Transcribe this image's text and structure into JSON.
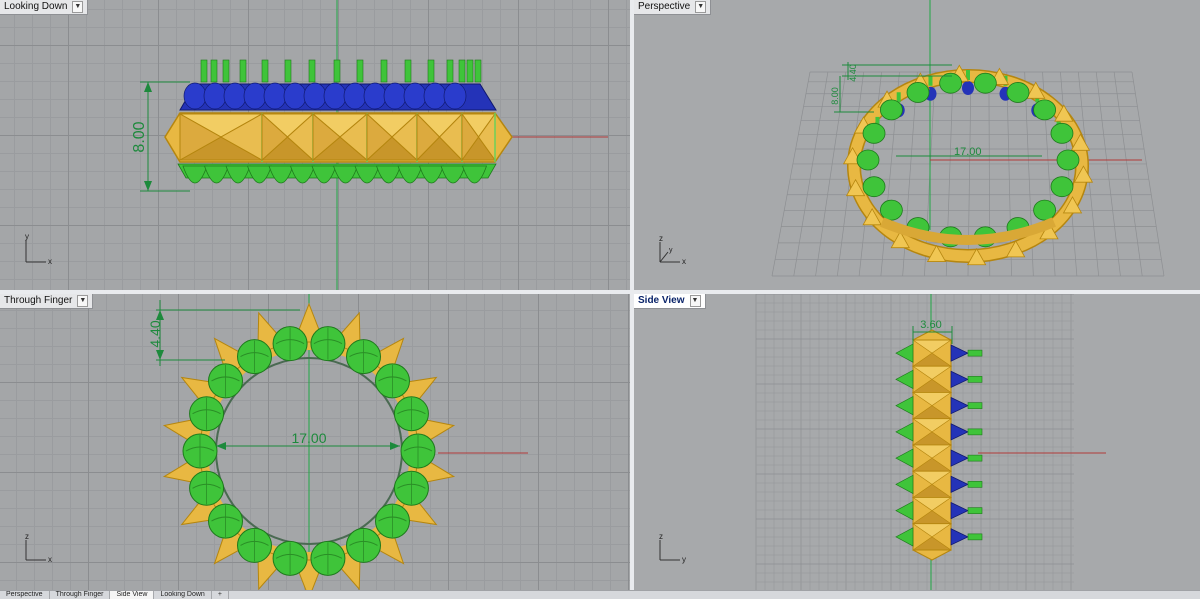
{
  "viewports": {
    "looking_down": {
      "title": "Looking Down",
      "dimension": "8.00",
      "axis_vertical": "y",
      "axis_horizontal": "x"
    },
    "perspective": {
      "title": "Perspective",
      "dimension_height": "4.40",
      "dimension_width": "8.00",
      "dimension_inner": "17.00",
      "axis_vertical": "z",
      "axis_horizontal": "x",
      "axis_depth": "y"
    },
    "through_finger": {
      "title": "Through Finger",
      "dimension_height": "4.40",
      "dimension_inner": "17.00",
      "axis_vertical": "z",
      "axis_horizontal": "x"
    },
    "side_view": {
      "title": "Side View",
      "dimension_width": "3.60",
      "axis_vertical": "z",
      "axis_horizontal": "y"
    }
  },
  "tabs": [
    "Perspective",
    "Through Finger",
    "Side View",
    "Looking Down",
    "+"
  ],
  "active_tab": "Side View",
  "colors": {
    "gold": "#e8b842",
    "gold_outline": "#b5860f",
    "green": "#3fc43a",
    "blue": "#2433b8",
    "dimension": "#1d8a3c",
    "axis_red": "#b23a3a",
    "viewport_bg": "#a4a6a8"
  },
  "icons": [
    "dropdown-arrow-icon",
    "axis-gizmo-icon"
  ]
}
